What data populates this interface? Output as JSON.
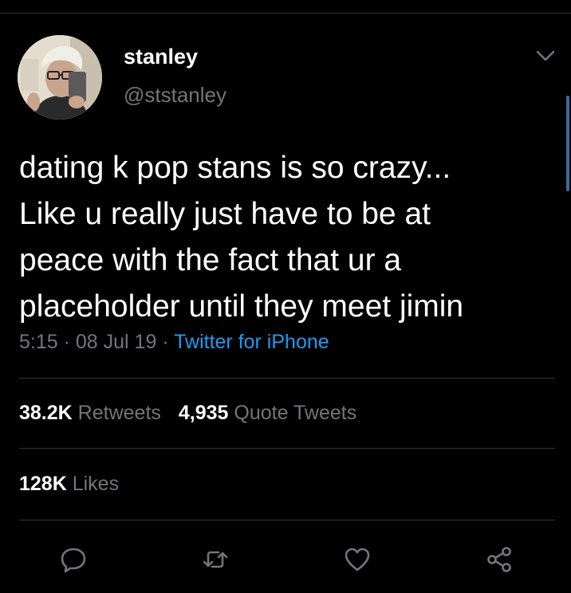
{
  "user": {
    "name": "stanley",
    "handle": "@ststanley"
  },
  "tweet": {
    "lines": [
      "dating k pop stans is so crazy...",
      "Like u really just have to be at",
      "peace with the fact that ur a",
      "placeholder until they meet jimin"
    ]
  },
  "meta": {
    "time": "5:15",
    "separator": " · ",
    "date": "08 Jul 19",
    "source": "Twitter for iPhone"
  },
  "stats": {
    "retweets_count": "38.2K",
    "retweets_label": "Retweets",
    "quotes_count": "4,935",
    "quotes_label": "Quote Tweets",
    "likes_count": "128K",
    "likes_label": "Likes"
  },
  "actions": {
    "reply": "reply-icon",
    "retweet": "retweet-icon",
    "like": "heart-icon",
    "share": "share-icon"
  },
  "colors": {
    "background": "#000000",
    "text": "#ffffff",
    "muted": "#71767b",
    "accent": "#1d9bf0",
    "divider": "#2f3336"
  }
}
